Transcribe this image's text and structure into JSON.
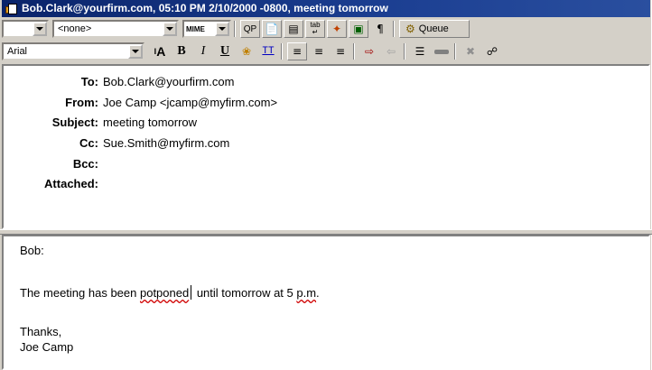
{
  "window": {
    "title": "Bob.Clark@yourfirm.com, 05:10 PM 2/10/2000 -0800, meeting tomorrow"
  },
  "toolbar1": {
    "signature_combo": "",
    "personality_combo": "<none>",
    "mime_label": "MIME",
    "qp_label": "QP",
    "queue_label": "Queue"
  },
  "toolbar2": {
    "font_combo": "Arial",
    "bold_label": "B",
    "italic_label": "I",
    "underline_label": "U",
    "teletype_label": "TT",
    "size_label": "A"
  },
  "headers": {
    "to": {
      "label": "To:",
      "value": "Bob.Clark@yourfirm.com"
    },
    "from": {
      "label": "From:",
      "value": "Joe Camp <jcamp@myfirm.com>"
    },
    "subject": {
      "label": "Subject:",
      "value": "meeting tomorrow"
    },
    "cc": {
      "label": "Cc:",
      "value": "Sue.Smith@myfirm.com"
    },
    "bcc": {
      "label": "Bcc:",
      "value": ""
    },
    "attached": {
      "label": "Attached:",
      "value": ""
    }
  },
  "message": {
    "greeting": "Bob:",
    "line_prefix": "The meeting has been ",
    "misspelled_word": "potponed",
    "line_middle": " until tomorrow at 5 ",
    "misspelled_time": "p.m",
    "line_end": ".",
    "closing": "Thanks,",
    "signature": "Joe Camp"
  },
  "colors": {
    "titlebar": "#0a246a",
    "chrome": "#d4d0c8",
    "spell_underline": "#d00000"
  }
}
